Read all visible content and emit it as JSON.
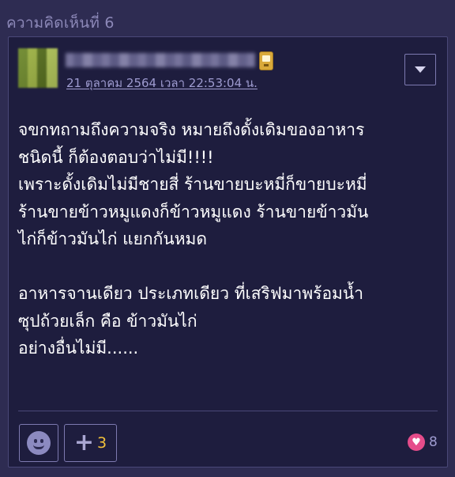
{
  "comment": {
    "number_label": "ความคิดเห็นที่ 6",
    "author": {
      "avatar_icon": "blurred-avatar",
      "badge_icon": "member-badge-icon"
    },
    "timestamp": "21 ตุลาคม 2564 เวลา 22:53:04 น.",
    "menu_icon": "caret-down-icon",
    "body_lines": [
      "จขกทถามถึงความจริง หมายถึงดั้งเดิมของอาหาร",
      "ชนิดนี้ ก็ต้องตอบว่าไม่มี!!!!",
      "เพราะดั้งเดิมไม่มีชายสี่ ร้านขายบะหมี่ก็ขายบะหมี่",
      "ร้านขายข้าวหมูแดงก็ข้าวหมูแดง ร้านขายข้าวมัน",
      "ไก่ก็ข้าวมันไก่ แยกกันหมด",
      "",
      "อาหารจานเดียว ประเภทเดียว ที่เสริฟมาพร้อมน้ำ",
      "ซุปถ้วยเล็ก คือ ข้าวมันไก่",
      "อย่างอื่นไม่มี......"
    ],
    "actions": {
      "emoji_icon": "smiley-icon",
      "plus_icon": "plus-icon",
      "plus_count": "3",
      "heart_icon": "heart-icon",
      "reaction_count": "8"
    }
  },
  "colors": {
    "page_bg": "#2e2c52",
    "card_bg": "#1e1d3e",
    "border": "#7d7ab0",
    "text": "#ffffff",
    "muted": "#9e9bd0",
    "accent_yellow": "#f2c13b",
    "heart_pink": "#e54c8a"
  }
}
